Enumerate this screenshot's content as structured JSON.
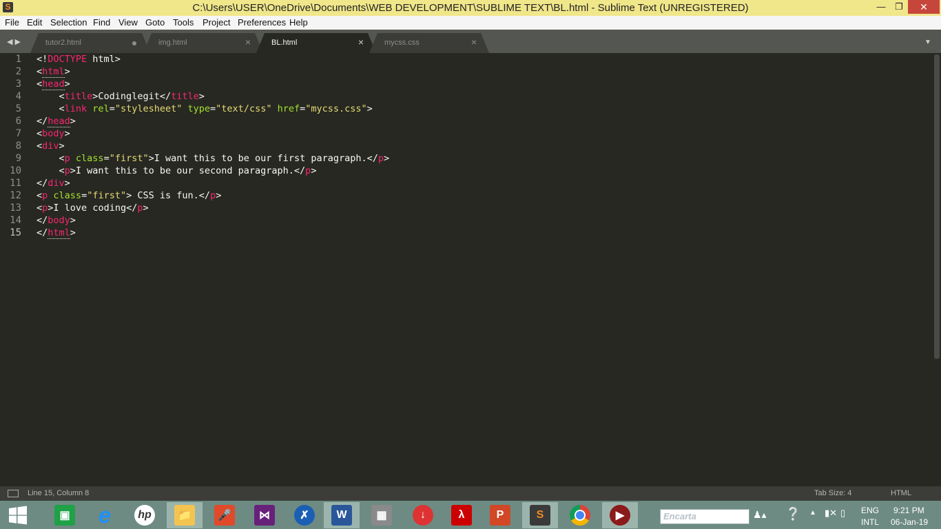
{
  "window": {
    "title": "C:\\Users\\USER\\OneDrive\\Documents\\WEB DEVELOPMENT\\SUBLIME TEXT\\BL.html - Sublime Text (UNREGISTERED)"
  },
  "menu": [
    "File",
    "Edit",
    "Selection",
    "Find",
    "View",
    "Goto",
    "Tools",
    "Project",
    "Preferences",
    "Help"
  ],
  "tabs": [
    {
      "label": "tutor2.html",
      "state": "modified"
    },
    {
      "label": "img.html",
      "state": "saved"
    },
    {
      "label": "BL.html",
      "state": "active"
    },
    {
      "label": "mycss.css",
      "state": "saved"
    }
  ],
  "editor": {
    "line_numbers": [
      "1",
      "2",
      "3",
      "4",
      "5",
      "6",
      "7",
      "8",
      "9",
      "10",
      "11",
      "12",
      "13",
      "14",
      "15"
    ],
    "current_line": 15,
    "lines": [
      "<!DOCTYPE html>",
      "<html>",
      "<head>",
      "    <title>Codinglegit</title>",
      "    <link rel=\"stylesheet\" type=\"text/css\" href=\"mycss.css\">",
      "</head>",
      "<body>",
      "<div>",
      "    <p class=\"first\">I want this to be our first paragraph.</p>",
      "    <p>I want this to be our second paragraph.</p>",
      "</div>",
      "<p class=\"first\"> CSS is fun.</p>",
      "<p>I love coding</p>",
      "</body>",
      "</html>"
    ]
  },
  "statusbar": {
    "position": "Line 15, Column 8",
    "tab_size": "Tab Size: 4",
    "syntax": "HTML"
  },
  "taskbar": {
    "apps": [
      {
        "name": "start",
        "icon": "windows-logo-icon"
      },
      {
        "name": "store",
        "icon": "store-icon"
      },
      {
        "name": "internet-explorer",
        "icon": "ie-icon"
      },
      {
        "name": "hp",
        "icon": "hp-icon"
      },
      {
        "name": "file-explorer",
        "icon": "folder-icon"
      },
      {
        "name": "recorder",
        "icon": "microphone-icon"
      },
      {
        "name": "visual-studio",
        "icon": "vs-icon"
      },
      {
        "name": "bluetooth",
        "icon": "bluetooth-icon"
      },
      {
        "name": "word",
        "icon": "word-icon"
      },
      {
        "name": "firewall",
        "icon": "wall-icon"
      },
      {
        "name": "downloader",
        "icon": "download-icon"
      },
      {
        "name": "acrobat",
        "icon": "pdf-icon"
      },
      {
        "name": "powerpoint",
        "icon": "powerpoint-icon"
      },
      {
        "name": "sublime-text",
        "icon": "sublime-icon"
      },
      {
        "name": "chrome",
        "icon": "chrome-icon"
      },
      {
        "name": "media-player",
        "icon": "media-icon"
      }
    ],
    "search_text": "Encarta",
    "language": "ENG",
    "layout": "INTL",
    "time": "9:21 PM",
    "date": "06-Jan-19"
  }
}
